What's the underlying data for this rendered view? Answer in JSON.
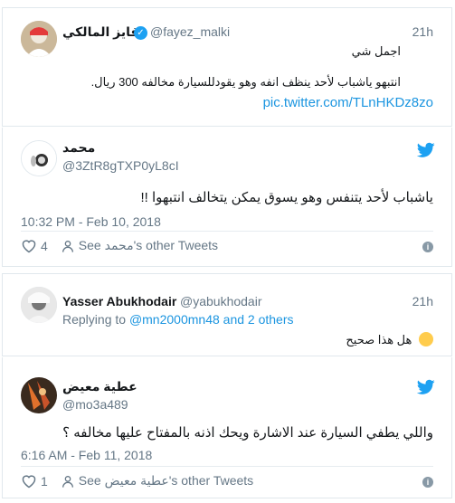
{
  "tweet1": {
    "name": "فايز المالكي",
    "handle": "@fayez_malki",
    "time": "21h",
    "line1": "اجمل شي",
    "line2": "انتبهو ياشباب لأحد ينظف انفه وهو يقودللسيارة مخالفه 300 ريال.",
    "link": "pic.twitter.com/TLnHKDz8zo"
  },
  "embed1": {
    "name": "محمد",
    "handle": "@3ZtR8gTXP0yL8cI",
    "text": "ياشباب لأحد يتنفس وهو يسوق يمكن يتخالف انتبهوا !!",
    "timestamp": "10:32 PM - Feb 10, 2018",
    "likes": "4",
    "see_prefix": "See",
    "see_name": "محمد",
    "see_suffix": "'s other Tweets"
  },
  "tweet2": {
    "name": "Yasser Abukhodair",
    "handle": "@yabukhodair",
    "time": "21h",
    "replying_prefix": "Replying to",
    "replying_user": "@mn2000mn48",
    "replying_suffix": "and 2 others",
    "text": "هل هذا صحيح"
  },
  "embed2": {
    "name": "عطية معيض",
    "handle": "@mo3a489",
    "text": "واللي يطفي السيارة عند الاشارة ويحك اذنه بالمفتاح عليها مخالفه ؟",
    "timestamp": "6:16 AM - Feb 11, 2018",
    "likes": "1",
    "see_prefix": "See",
    "see_name": "عطية معيض",
    "see_suffix": "'s other Tweets"
  },
  "colors": {
    "twitter_blue": "#1da1f2",
    "link": "#1b95e0",
    "muted": "#657786",
    "border": "#e1e8ed"
  }
}
